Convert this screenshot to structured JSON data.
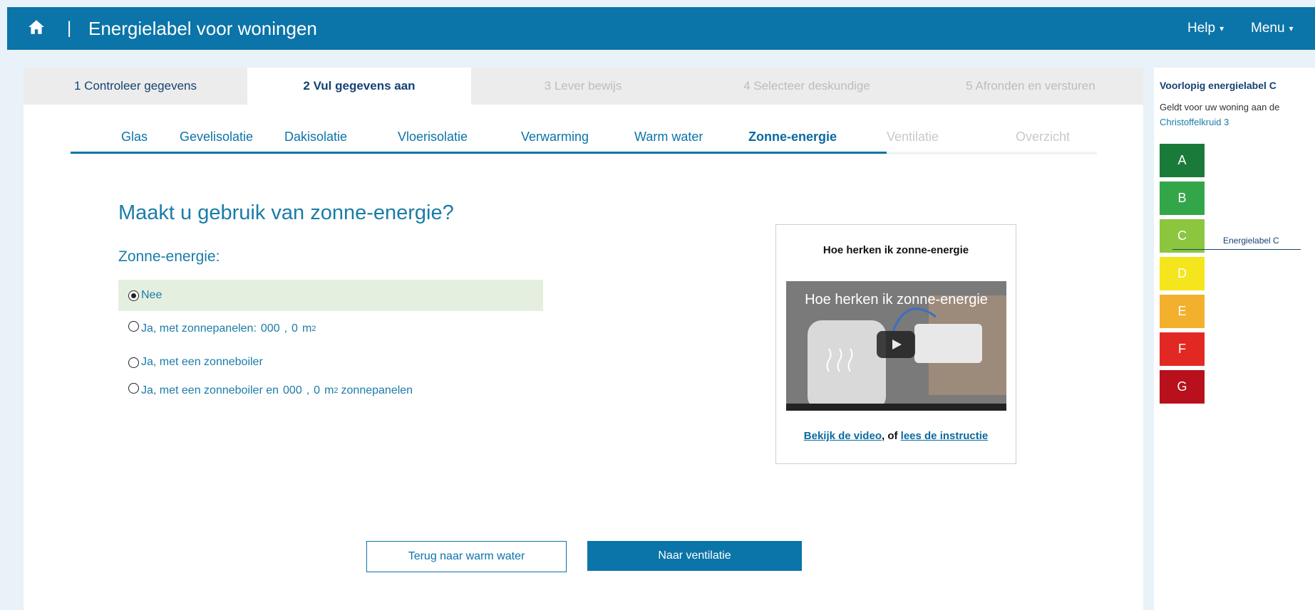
{
  "header": {
    "title": "Energielabel voor woningen",
    "separator": "|",
    "help": "Help",
    "menu": "Menu",
    "caret": "▾"
  },
  "steps": [
    {
      "label": "1 Controleer gegevens",
      "state": "done"
    },
    {
      "label": "2 Vul gegevens aan",
      "state": "active"
    },
    {
      "label": "3 Lever bewijs",
      "state": "disabled"
    },
    {
      "label": "4 Selecteer deskundige",
      "state": "disabled"
    },
    {
      "label": "5 Afronden en versturen",
      "state": "disabled"
    }
  ],
  "tabs": [
    {
      "label": "Glas",
      "state": "normal"
    },
    {
      "label": "Gevelisolatie",
      "state": "normal"
    },
    {
      "label": "Dakisolatie",
      "state": "normal"
    },
    {
      "label": "Vloerisolatie",
      "state": "normal"
    },
    {
      "label": "Verwarming",
      "state": "normal"
    },
    {
      "label": "Warm water",
      "state": "normal"
    },
    {
      "label": "Zonne-energie",
      "state": "active"
    },
    {
      "label": "Ventilatie",
      "state": "disabled"
    },
    {
      "label": "Overzicht",
      "state": "disabled"
    }
  ],
  "question": "Maakt u gebruik van zonne-energie?",
  "field_label": "Zonne-energie:",
  "options": {
    "nee": "Nee",
    "panelen_prefix": "Ja, met zonnepanelen:",
    "panelen_int": "000",
    "panelen_comma": ",",
    "panelen_dec": "0",
    "panelen_unit": "m",
    "sup2": "2",
    "boiler": "Ja, met een zonneboiler",
    "combi_prefix": "Ja, met een zonneboiler en",
    "combi_int": "000",
    "combi_comma": ",",
    "combi_dec": "0",
    "combi_unit": "m",
    "combi_suffix": "zonnepanelen",
    "selected": "nee"
  },
  "video": {
    "title": "Hoe herken ik zonne-energie",
    "thumb_caption": "Hoe herken ik zonne-energie",
    "link_video": "Bekijk de video",
    "link_middle": ", of ",
    "link_instructie": "lees de instructie"
  },
  "buttons": {
    "back": "Terug naar warm water",
    "next": "Naar ventilatie"
  },
  "sidebar": {
    "title": "Voorlopig energielabel C",
    "text": "Geldt voor uw woning aan de",
    "address": "Christoffelkruid 3",
    "pointer_label": "Energielabel C",
    "labels": [
      {
        "letter": "A",
        "color": "#1a7a3a"
      },
      {
        "letter": "B",
        "color": "#34a64a"
      },
      {
        "letter": "C",
        "color": "#8cc63e"
      },
      {
        "letter": "D",
        "color": "#f5e51c"
      },
      {
        "letter": "E",
        "color": "#f3b02c"
      },
      {
        "letter": "F",
        "color": "#e22822"
      },
      {
        "letter": "G",
        "color": "#b8101c"
      }
    ]
  },
  "colors": {
    "brand": "#0b74a8",
    "selected_option_bg": "#e5efe0"
  }
}
